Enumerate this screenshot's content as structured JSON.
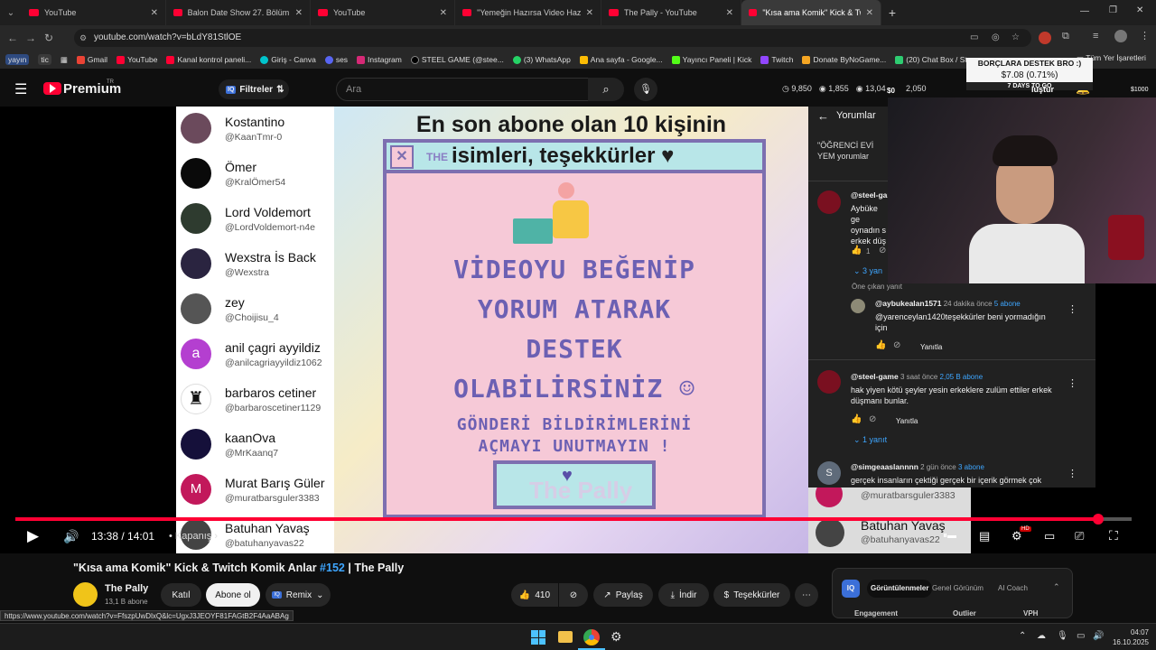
{
  "browser": {
    "tabs": [
      {
        "title": "YouTube"
      },
      {
        "title": "Balon Date Show 27. Bölüm Fra"
      },
      {
        "title": "YouTube"
      },
      {
        "title": "\"Yemeğin Hazırsa Video Hazır\""
      },
      {
        "title": "The Pally - YouTube"
      },
      {
        "title": "\"Kısa ama Komik\" Kick & Twitch"
      }
    ],
    "url": "youtube.com/watch?v=bLdY81StlOE",
    "bookmarks": [
      "yayın",
      "tic",
      "Gmail",
      "YouTube",
      "Kanal kontrol paneli...",
      "Giriş - Canva",
      "ses",
      "Instagram",
      "STEEL GAME (@stee...",
      "(3) WhatsApp",
      "Ana sayfa - Google...",
      "Yayıncı Paneli | Kick",
      "Twitch",
      "Donate ByNoGame...",
      "(20) Chat Box / Stre...",
      "Tüm Yer İşaretleri"
    ]
  },
  "youtube": {
    "logo": "Premium",
    "region": "TR",
    "filters_label": "Filtreler",
    "search_placeholder": "Ara",
    "stats": [
      "9,850",
      "1,855",
      "13,04"
    ],
    "stat2": "2,050",
    "stream_tag": "$1000"
  },
  "subscribers": [
    {
      "name": "Kostantino",
      "handle": "@KaanTmr-0"
    },
    {
      "name": "Ömer",
      "handle": "@KralÖmer54"
    },
    {
      "name": "Lord Voldemort",
      "handle": "@LordVoldemort-n4e"
    },
    {
      "name": "Wexstra İs Back",
      "handle": "@Wexstra"
    },
    {
      "name": "zey",
      "handle": "@Choijisu_4"
    },
    {
      "name": "anil çagri ayyildiz",
      "handle": "@anilcagriayyildiz1062"
    },
    {
      "name": "barbaros cetiner",
      "handle": "@barbaroscetiner1129"
    },
    {
      "name": "kaanOva",
      "handle": "@MrKaanq7"
    },
    {
      "name": "Murat Barış Güler",
      "handle": "@muratbarsguler3383"
    },
    {
      "name": "Batuhan Yavaş",
      "handle": "@batuhanyavas22"
    }
  ],
  "avatar_letters": {
    "anil": "a",
    "murat": "M"
  },
  "poster": {
    "title_line1": "En son abone olan 10 kişinin",
    "title_line2": "isimleri, teşekkürler",
    "badge": "THE",
    "line1": "VİDEOYU BEĞENİP",
    "line2": "YORUM ATARAK",
    "line3": "DESTEK",
    "line4": "OLABİLİRSİNİZ",
    "line5": "GÖNDERİ BİLDİRİMLERİNİ",
    "line6": "AÇMAYI UNUTMAYIN !",
    "watermark": "The Pally"
  },
  "comments_panel": {
    "title": "Yorumlar",
    "context": "\"ÖĞRENCİ EVİ YEM yorumlar",
    "c1_user": "@steel-gam",
    "c1_text": "Aybüke ge oynadın s erkek düş",
    "c1_likes": "1",
    "c1_replies": "3 yan",
    "pinned_label": "Öne çıkan yanıt",
    "r1_user": "@aybukealan1571",
    "r1_time": "24 dakika önce",
    "r1_subs": "5 abone",
    "r1_text": "@yarenceylan1420teşekkürler beni yormadığın için",
    "reply_label": "Yanıtla",
    "c2_user": "@steel-game",
    "c2_time": "3 saat önce",
    "c2_subs": "2,05 B abone",
    "c2_text": "hak yiyen kötü şeyler yesin erkeklere zulüm ettiler erkek düşmanı bunlar.",
    "c2_replies": "1 yanıt",
    "c3_user": "@simgeaaslannnn",
    "c3_time": "2 gün önce",
    "c3_subs": "3 abone",
    "c3_text": "gerçek insanların çektiği gerçek bir içerik görmek çok",
    "c3_avatar": "S"
  },
  "donation": {
    "title": "BORÇLARA DESTEK BRO :)",
    "amount": "$7.08 (0.71%)",
    "days": "7 DAYS TO GO",
    "left": "$0",
    "right_word": "luştur"
  },
  "player": {
    "time": "13:38 / 14:01",
    "chapter": "Kapanış",
    "progress": 0.97
  },
  "video": {
    "title": "\"Kısa ama Komik\" Kick & Twitch Komik Anlar",
    "hashtag": "#152",
    "title_suffix": "| The Pally",
    "channel": "The Pally",
    "channel_subs": "13,1 B abone",
    "join": "Katıl",
    "subscribe": "Abone ol",
    "remix": "Remix",
    "likes": "410",
    "share": "Paylaş",
    "download": "İndir",
    "thanks": "Teşekkürler"
  },
  "ext_panel": {
    "tab1": "Görüntülenmeler",
    "tab2": "Genel Görünüm",
    "tab3": "AI Coach",
    "col1": "Engagement",
    "col2": "Outlier",
    "col3": "VPH"
  },
  "status_url": "https://www.youtube.com/watch?v=FfszpUwDlxQ&lc=UgxJ3JEOYF81FAGtB2F4AaABAg",
  "clock": {
    "time": "04:07",
    "date": "16.10.2025"
  }
}
